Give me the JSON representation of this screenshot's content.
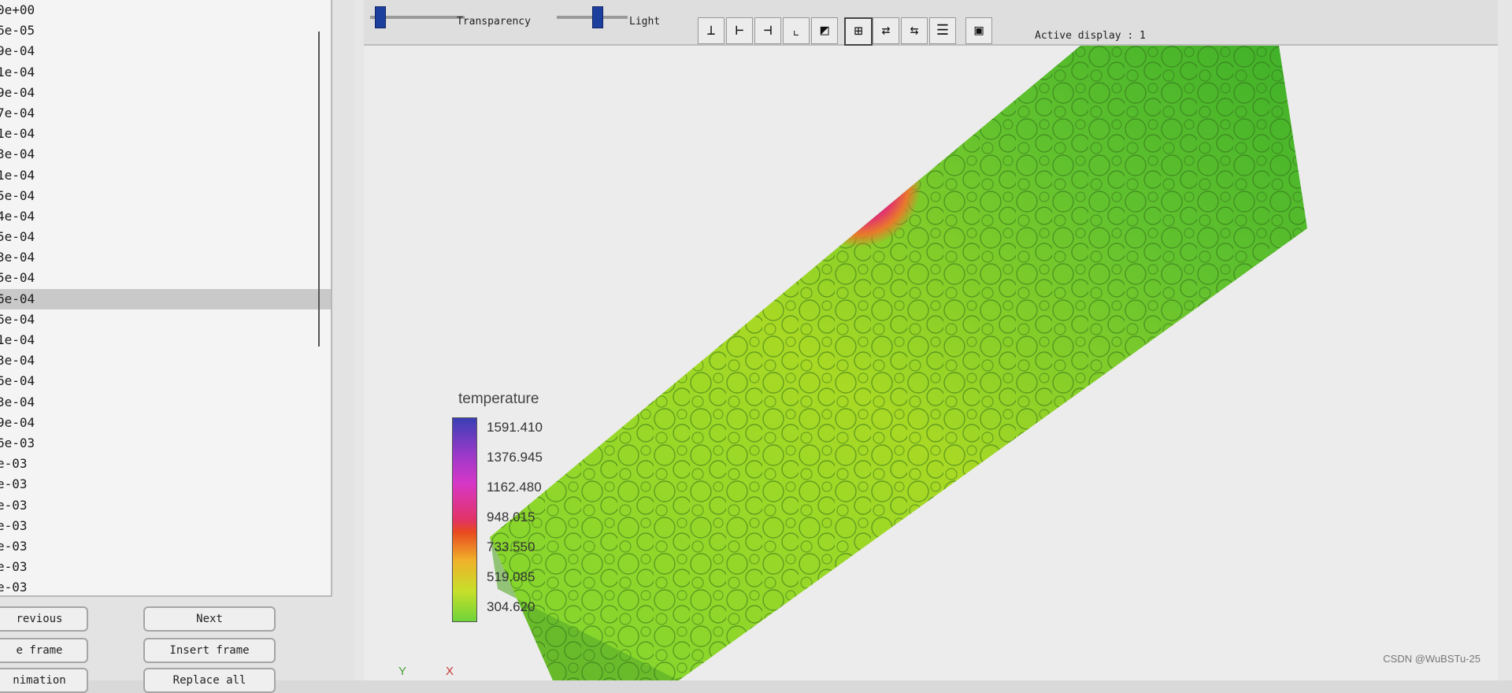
{
  "left_panel": {
    "time_values": [
      "0e+00",
      "6e-05",
      "9e-04",
      "1e-04",
      "9e-04",
      "7e-04",
      "1e-04",
      "3e-04",
      "1e-04",
      "5e-04",
      "4e-04",
      "5e-04",
      "3e-04",
      "5e-04",
      "6e-04",
      "6e-04",
      "1e-04",
      "3e-04",
      "6e-04",
      "3e-04",
      "9e-04",
      "6e-03",
      "e-03",
      "e-03",
      "e-03",
      "e-03",
      "e-03",
      "e-03",
      "e-03"
    ],
    "selected_index": 14,
    "buttons": {
      "previous": "revious",
      "next": "Next",
      "frame": "e frame",
      "insert_frame": "Insert frame",
      "animation": "nimation",
      "replace_all": "Replace all"
    }
  },
  "toolbar": {
    "transparency_label": "Transparency",
    "light_label": "Light",
    "transparency_level": 0.05,
    "light_level": 0.5,
    "active_display_text": "Active display : 1",
    "tool_icons": [
      "axis-x-icon",
      "axis-y-icon",
      "axis-z-icon",
      "axis-corner-icon",
      "shade-icon",
      "frame-icon",
      "rotate-icon",
      "split-icon",
      "list-icon",
      "record-icon"
    ]
  },
  "legend": {
    "title": "temperature",
    "ticks": [
      "1591.410",
      "1376.945",
      "1162.480",
      "948.015",
      "733.550",
      "519.085",
      "304.620"
    ]
  },
  "axes_labels": {
    "y": "Y",
    "x": "X"
  },
  "watermark": "CSDN @WuBSTu-25"
}
